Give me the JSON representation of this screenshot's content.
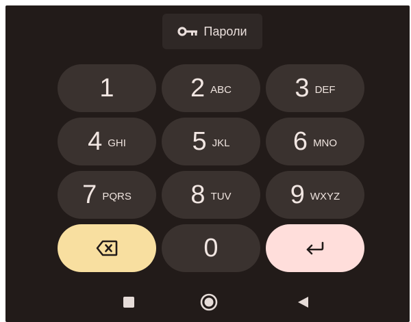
{
  "suggestion": {
    "icon": "key-icon",
    "label": "Пароли"
  },
  "keys": [
    {
      "digit": "1",
      "letters": ""
    },
    {
      "digit": "2",
      "letters": "ABC"
    },
    {
      "digit": "3",
      "letters": "DEF"
    },
    {
      "digit": "4",
      "letters": "GHI"
    },
    {
      "digit": "5",
      "letters": "JKL"
    },
    {
      "digit": "6",
      "letters": "MNO"
    },
    {
      "digit": "7",
      "letters": "PQRS"
    },
    {
      "digit": "8",
      "letters": "TUV"
    },
    {
      "digit": "9",
      "letters": "WXYZ"
    },
    {
      "digit": "0",
      "letters": ""
    }
  ],
  "actions": {
    "backspace_icon": "backspace-icon",
    "enter_icon": "enter-icon"
  },
  "navigation": {
    "recents_icon": "square-icon",
    "home_icon": "circle-icon",
    "back_icon": "triangle-back-icon"
  },
  "colors": {
    "background": "#221b19",
    "key": "#3a322f",
    "suggestion": "#2f2826",
    "backspace": "#f8dfa0",
    "enter": "#ffdedb",
    "text": "#f1e6e2"
  }
}
